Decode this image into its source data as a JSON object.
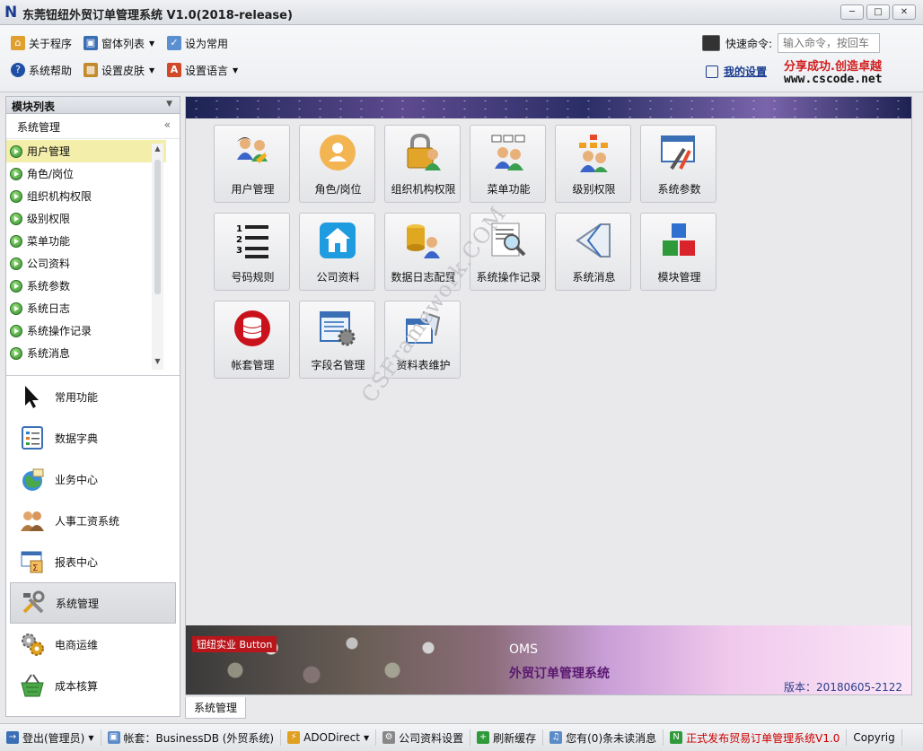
{
  "window": {
    "title": "东莞钮纽外贸订单管理系统 V1.0(2018-release)",
    "logo_letter": "N"
  },
  "toolbar": {
    "row1": [
      {
        "label": "关于程序",
        "icon": "home-icon"
      },
      {
        "label": "窗体列表",
        "icon": "window-list-icon",
        "dropdown": true
      },
      {
        "label": "设为常用",
        "icon": "favorite-icon"
      }
    ],
    "row2": [
      {
        "label": "系统帮助",
        "icon": "help-icon"
      },
      {
        "label": "设置皮肤",
        "icon": "skin-icon",
        "dropdown": true
      },
      {
        "label": "设置语言",
        "icon": "language-icon",
        "dropdown": true
      }
    ],
    "quick_command_label": "快速命令:",
    "quick_command_placeholder": "输入命令，按回车",
    "my_settings": "我的设置",
    "brand_line1": "分享成功.创造卓越",
    "brand_line2": "www.cscode.net"
  },
  "left_panel": {
    "header": "模块列表",
    "section": "系统管理",
    "tree_items": [
      "用户管理",
      "角色/岗位",
      "组织机构权限",
      "级别权限",
      "菜单功能",
      "公司资料",
      "系统参数",
      "系统日志",
      "系统操作记录",
      "系统消息"
    ],
    "selected_index": 0,
    "modules": [
      {
        "label": "常用功能",
        "icon": "cursor-icon"
      },
      {
        "label": "数据字典",
        "icon": "dictionary-icon"
      },
      {
        "label": "业务中心",
        "icon": "business-globe-icon"
      },
      {
        "label": "人事工资系统",
        "icon": "hr-people-icon"
      },
      {
        "label": "报表中心",
        "icon": "report-icon"
      },
      {
        "label": "系统管理",
        "icon": "tools-icon",
        "active": true
      },
      {
        "label": "电商运维",
        "icon": "gears-icon"
      },
      {
        "label": "成本核算",
        "icon": "basket-icon"
      }
    ]
  },
  "tiles": [
    {
      "label": "用户管理",
      "icon": "users-icon"
    },
    {
      "label": "角色/岗位",
      "icon": "role-icon"
    },
    {
      "label": "组织机构权限",
      "icon": "lock-users-icon"
    },
    {
      "label": "菜单功能",
      "icon": "menu-users-icon"
    },
    {
      "label": "级别权限",
      "icon": "hierarchy-users-icon"
    },
    {
      "label": "系统参数",
      "icon": "system-settings-icon"
    },
    {
      "label": "号码规则",
      "icon": "numbered-list-icon"
    },
    {
      "label": "公司资料",
      "icon": "company-home-icon"
    },
    {
      "label": "数据日志配置",
      "icon": "database-log-icon"
    },
    {
      "label": "系统操作记录",
      "icon": "search-log-icon"
    },
    {
      "label": "系统消息",
      "icon": "message-icon"
    },
    {
      "label": "模块管理",
      "icon": "module-blocks-icon"
    },
    {
      "label": "帐套管理",
      "icon": "account-db-icon"
    },
    {
      "label": "字段名管理",
      "icon": "field-config-icon"
    },
    {
      "label": "资料表维护",
      "icon": "table-maintain-icon"
    }
  ],
  "watermark": "CSFramework.COM",
  "banner": {
    "tag": "钮纽实业 Button",
    "product": "OMS",
    "product_name": "外贸订单管理系统",
    "version": "版本：20180605-2122"
  },
  "main_tab": "系统管理",
  "statusbar": [
    {
      "label": "登出(管理员)",
      "icon": "logout-icon",
      "dropdown": true
    },
    {
      "label": "帐套：BusinessDB (外贸系统)",
      "icon": "network-icon"
    },
    {
      "label": "ADODirect",
      "icon": "lightning-icon",
      "dropdown": true
    },
    {
      "label": "公司资料设置",
      "icon": "gear-icon"
    },
    {
      "label": "刷新缓存",
      "icon": "refresh-icon"
    },
    {
      "label": "您有(0)条未读消息",
      "icon": "speaker-icon"
    },
    {
      "label": "正式发布贸易订单管理系统V1.0",
      "icon": "new-badge-icon",
      "release": true
    },
    {
      "label": "Copyrig",
      "icon": ""
    }
  ],
  "colors": {
    "accent": "#1a3c8f",
    "selection": "#f3eeaa",
    "release": "#cc0000"
  }
}
